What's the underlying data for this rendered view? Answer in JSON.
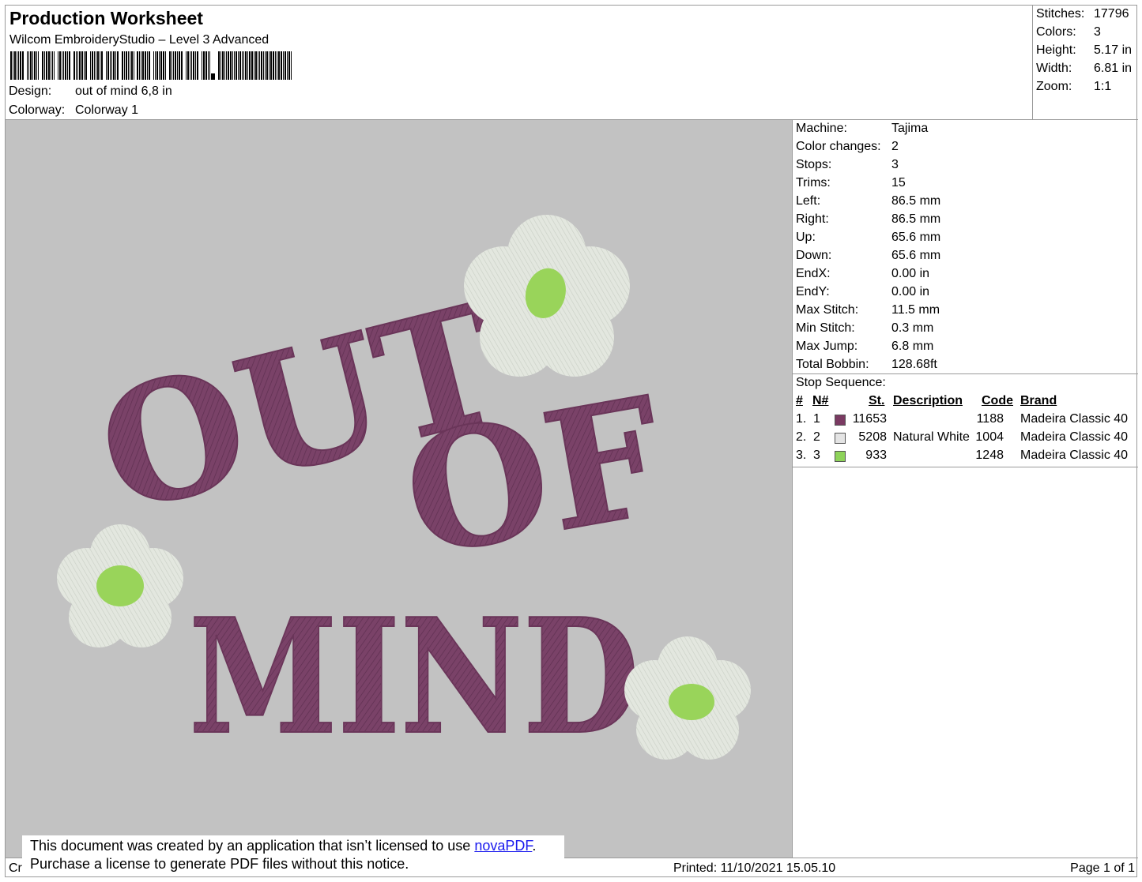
{
  "header": {
    "title": "Production Worksheet",
    "subtitle": "Wilcom EmbroideryStudio – Level 3 Advanced",
    "design_label": "Design:",
    "design_value": "out of mind 6,8 in",
    "colorway_label": "Colorway:",
    "colorway_value": "Colorway 1"
  },
  "stats": [
    {
      "label": "Stitches:",
      "value": "17796"
    },
    {
      "label": "Colors:",
      "value": "3"
    },
    {
      "label": "Height:",
      "value": "5.17 in"
    },
    {
      "label": "Width:",
      "value": "6.81 in"
    },
    {
      "label": "Zoom:",
      "value": "1:1"
    }
  ],
  "preview": {
    "line1": "OUT",
    "line2": "OF",
    "line3": "MIND",
    "colors": {
      "background": "#c2c2c2",
      "thread1": "#7a4268",
      "thread2": "#e3e7df",
      "thread3": "#99d45a"
    }
  },
  "machine": [
    {
      "label": "Machine:",
      "value": "Tajima"
    },
    {
      "label": "Color changes:",
      "value": "2"
    },
    {
      "label": "Stops:",
      "value": "3"
    },
    {
      "label": "Trims:",
      "value": "15"
    },
    {
      "label": "Left:",
      "value": "86.5 mm"
    },
    {
      "label": "Right:",
      "value": "86.5 mm"
    },
    {
      "label": "Up:",
      "value": "65.6 mm"
    },
    {
      "label": "Down:",
      "value": "65.6 mm"
    },
    {
      "label": "EndX:",
      "value": "0.00 in"
    },
    {
      "label": "EndY:",
      "value": "0.00 in"
    },
    {
      "label": "Max Stitch:",
      "value": "11.5 mm"
    },
    {
      "label": "Min Stitch:",
      "value": "0.3 mm"
    },
    {
      "label": "Max Jump:",
      "value": "6.8 mm"
    },
    {
      "label": "Total Bobbin:",
      "value": "128.68ft"
    }
  ],
  "stop_sequence": {
    "title": "Stop Sequence:",
    "headers": {
      "num": "#",
      "n": "N#",
      "st": "St.",
      "desc": "Description",
      "code": "Code",
      "brand": "Brand"
    },
    "rows": [
      {
        "num": "1.",
        "n": "1",
        "color": "#7a3a62",
        "st": "11653",
        "desc": "",
        "code": "1188",
        "brand": "Madeira Classic 40"
      },
      {
        "num": "2.",
        "n": "2",
        "color": "#e4e4e4",
        "st": "5208",
        "desc": "Natural White",
        "code": "1004",
        "brand": "Madeira Classic 40"
      },
      {
        "num": "3.",
        "n": "3",
        "color": "#8ed35a",
        "st": "933",
        "desc": "",
        "code": "1248",
        "brand": "Madeira Classic 40"
      }
    ]
  },
  "footer": {
    "created": "Cr",
    "printed": "Printed: 11/10/2021 15.05.10",
    "page": "Page 1 of 1"
  },
  "notice": {
    "line1_pre": "This document was created by an application that isn’t licensed to use ",
    "link": "novaPDF",
    "line1_post": ".",
    "line2": "Purchase a license to generate PDF files without this notice."
  }
}
